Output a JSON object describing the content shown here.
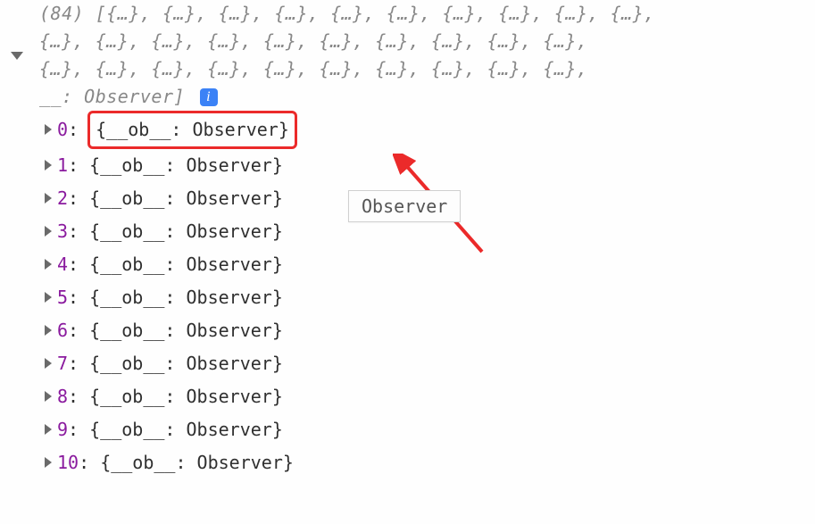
{
  "summary": {
    "count_label": "(84)",
    "bracket_open": "[",
    "placeholder": "{…}",
    "sep": ", ",
    "placeholder_repeat": 30,
    "tail_prefix": "__: ",
    "tail_value": "Observer",
    "bracket_close": "]",
    "info": "i"
  },
  "highlight_index": 0,
  "tooltip": "Observer",
  "item_template": {
    "open": "{",
    "key": "__ob__",
    "colon": ": ",
    "value": "Observer",
    "close": "}"
  },
  "items": [
    {
      "index": "0"
    },
    {
      "index": "1"
    },
    {
      "index": "2"
    },
    {
      "index": "3"
    },
    {
      "index": "4"
    },
    {
      "index": "5"
    },
    {
      "index": "6"
    },
    {
      "index": "7"
    },
    {
      "index": "8"
    },
    {
      "index": "9"
    },
    {
      "index": "10"
    }
  ]
}
